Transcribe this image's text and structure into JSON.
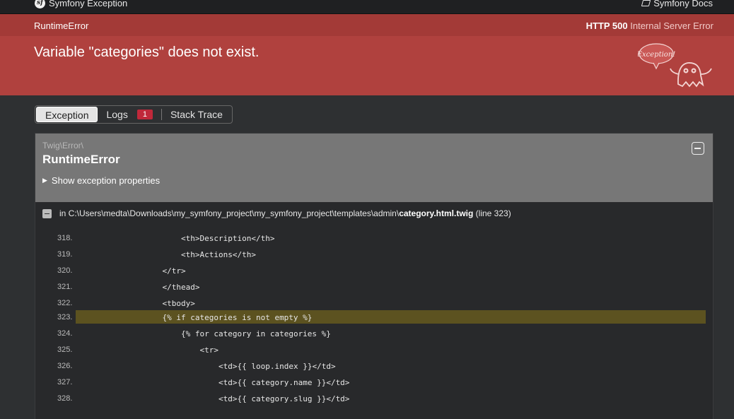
{
  "topbar": {
    "brand_label": "Symfony Exception",
    "brand_logo": "sf",
    "docs_label": "Symfony Docs"
  },
  "header": {
    "exception_class": "RuntimeError",
    "status_code": "HTTP 500",
    "status_text": "Internal Server Error",
    "message": "Variable \"categories\" does not exist.",
    "mascot_text": "Exception!"
  },
  "tabs": [
    {
      "label": "Exception",
      "active": true
    },
    {
      "label": "Logs",
      "badge": "1"
    },
    {
      "label": "Stack Trace"
    }
  ],
  "exception": {
    "namespace": "Twig\\Error\\",
    "class": "RuntimeError",
    "props_toggle": "Show exception properties",
    "file_prefix": "in C:\\Users\\medta\\Downloads\\my_symfony_project\\my_symfony_project\\templates\\admin\\",
    "file_name": "category.html.twig",
    "file_line": "(line 323)"
  },
  "code": {
    "highlight_line": "323.",
    "lines": [
      {
        "num": "318.",
        "indent": 6,
        "text": "<th>Description</th>"
      },
      {
        "num": "319.",
        "indent": 6,
        "text": "<th>Actions</th>"
      },
      {
        "num": "320.",
        "indent": 5,
        "text": "</tr>"
      },
      {
        "num": "321.",
        "indent": 5,
        "text": "</thead>"
      },
      {
        "num": "322.",
        "indent": 5,
        "text": "<tbody>"
      },
      {
        "num": "323.",
        "indent": 5,
        "text": "{% if categories is not empty %}"
      },
      {
        "num": "324.",
        "indent": 6,
        "text": "{% for category in categories %}"
      },
      {
        "num": "325.",
        "indent": 7,
        "text": "<tr>"
      },
      {
        "num": "326.",
        "indent": 8,
        "text": "<td>{{ loop.index }}</td>"
      },
      {
        "num": "327.",
        "indent": 8,
        "text": "<td>{{ category.name }}</td>"
      },
      {
        "num": "328.",
        "indent": 8,
        "text": "<td>{{ category.slug }}</td>"
      }
    ]
  },
  "colors": {
    "header_bg": "#b0413e",
    "highlight_bg": "#5c5220",
    "badge_bg": "#c0283a"
  }
}
